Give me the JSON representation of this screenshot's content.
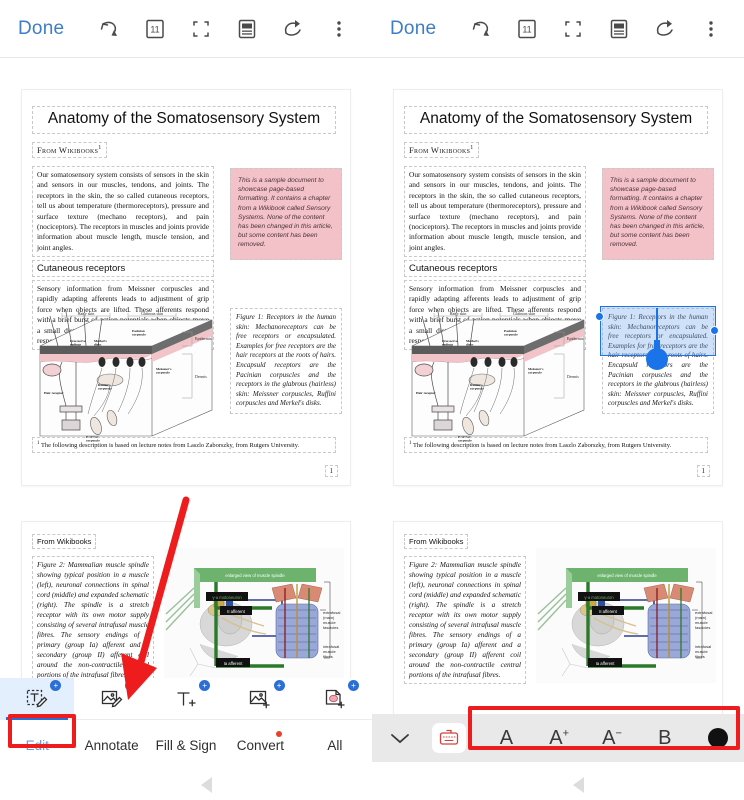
{
  "app": {
    "toolbar": {
      "done_label": "Done",
      "icons": [
        {
          "name": "undo-icon",
          "label": "Undo"
        },
        {
          "name": "page-count-icon",
          "label": "11"
        },
        {
          "name": "crop-icon",
          "label": "Crop"
        },
        {
          "name": "reading-mode-icon",
          "label": "Reading mode"
        },
        {
          "name": "share-icon",
          "label": "Share"
        },
        {
          "name": "more-options-icon",
          "label": "More"
        }
      ],
      "page_count": "11"
    },
    "document": {
      "title": "Anatomy of the Somatosensory System",
      "source": "From Wikibooks",
      "source_superscript": "1",
      "intro_paragraph": "Our somatosensory system consists of sensors in the skin and sensors in our muscles, tendons, and joints. The receptors in the skin, the so called cutaneous receptors, tell us about temperature (thermoreceptors), pressure and surface texture (mechano receptors), and pain (nociceptors). The receptors in muscles and joints provide information about muscle length, muscle tension, and joint angles.",
      "section_heading": "Cutaneous receptors",
      "section_paragraph": "Sensory information from Meissner corpuscles and rapidly adapting afferents leads to adjustment of grip force when objects are lifted. These afferents respond with a brief burst of action potentials when objects move a small distance during the early stages of lifting. In response to",
      "pink_note": "This is a sample document to showcase page-based formatting. It contains a chapter from a Wikibook called Sensory Systems. None of the content has been changed in this article, but some content has been removed.",
      "figure1_caption": "Figure 1:   Receptors in the human skin: Mechanoreceptors can be free receptors or encapsulated. Examples for free receptors are the hair receptors at the roots of hairs. Encapsuld receptors are the Pacinian corpuscles and the receptors in the glabrous (hairless) skin: Meissner corpuscles, Ruffini corpuscles and Merkel's disks.",
      "footnote_marker": "1",
      "footnote": "The following description is based on lecture notes from Laszlo Zaborszky, from Rutgers University.",
      "page_number": "1",
      "figure1_labels": {
        "hairy_skin": "Hairy skin",
        "glabrous_skin": "Glabrous skin",
        "epidermis": "Epidermis",
        "dermis": "Dermis",
        "free_nerve": "Free nerve endings",
        "merkel": "Merkel's disks",
        "meissner": "Meissner's corpuscle",
        "ruffini": "Ruffini's corpuscle",
        "pacinian": "Pacinian corpuscle",
        "hair_receptor": "Hair receptor"
      }
    },
    "document_page2": {
      "source": "From Wikibooks",
      "figure2_caption": "Figure 2:   Mammalian muscle spindle showing typical position in a muscle (left), neuronal connections in spinal cord (middle) and expanded schematic (right). The spindle is a stretch receptor with its own motor supply consisting of several intrafusal muscle fibres. The sensory endings of a primary (group Ia) afferent and a secondary (group II) afferent coil around the non-contractile central portions of the intrafusal fibres.",
      "figure2_labels": {
        "enlarged": "enlarged view of muscle spindle",
        "gamma": "γ-a motoneuron",
        "ii_afferent": "II afferent",
        "ia_afferent": "Ia afferent",
        "extrafusal": "extrafusal (main) muscle fascicles",
        "intrafusal": "intrafusal muscle fibres"
      }
    },
    "edit_tools": [
      {
        "name": "edit-text-tool",
        "label": "Edit Text",
        "badge": "+",
        "active": true
      },
      {
        "name": "edit-image-tool",
        "label": "Edit Image",
        "badge": "+",
        "active": false
      },
      {
        "name": "add-text-tool",
        "label": "Add Text",
        "badge": "+",
        "active": false
      },
      {
        "name": "add-image-tool",
        "label": "Add Image",
        "badge": "+",
        "active": false
      },
      {
        "name": "add-stamp-tool",
        "label": "Add Stamp",
        "badge": "+",
        "active": false
      }
    ],
    "tabs": [
      {
        "name": "tab-edit",
        "label": "Edit",
        "selected": true,
        "dot": false
      },
      {
        "name": "tab-annotate",
        "label": "Annotate",
        "selected": false,
        "dot": false
      },
      {
        "name": "tab-fill-sign",
        "label": "Fill & Sign",
        "selected": false,
        "dot": false
      },
      {
        "name": "tab-convert",
        "label": "Convert",
        "selected": false,
        "dot": true
      },
      {
        "name": "tab-all",
        "label": "All",
        "selected": false,
        "dot": false
      }
    ],
    "format_bar": {
      "collapse_label": "Collapse",
      "keyboard_label": "Keyboard",
      "items": [
        {
          "name": "font-button",
          "label": "A",
          "sup": ""
        },
        {
          "name": "increase-font-button",
          "label": "A",
          "sup": "+"
        },
        {
          "name": "decrease-font-button",
          "label": "A",
          "sup": "−"
        },
        {
          "name": "bold-button",
          "label": "B",
          "sup": ""
        },
        {
          "name": "text-color-button",
          "label": "",
          "sup": ""
        }
      ],
      "text_color": "#111111"
    },
    "selection": {
      "highlight_color": "#1a73e8",
      "highlight_fill": "rgba(110,168,238,0.34)"
    },
    "annotations": {
      "arrow_color": "#ee1c1c",
      "rect_color": "#ee1c1c",
      "edit_tab_highlight": "Edit",
      "format_bar_highlight": "Text formatting toolbar"
    }
  }
}
